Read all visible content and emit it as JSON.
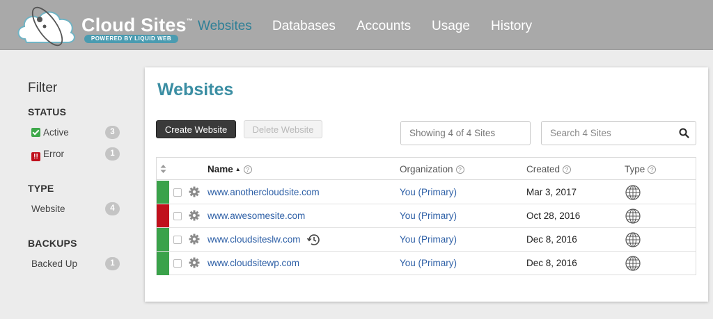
{
  "brand": {
    "title": "Cloud Sites",
    "trademark": "™",
    "tagline": "POWERED BY LIQUID WEB"
  },
  "nav": {
    "items": [
      {
        "label": "Websites",
        "active": true
      },
      {
        "label": "Databases",
        "active": false
      },
      {
        "label": "Accounts",
        "active": false
      },
      {
        "label": "Usage",
        "active": false
      },
      {
        "label": "History",
        "active": false
      }
    ]
  },
  "sidebar": {
    "title": "Filter",
    "status": {
      "heading": "STATUS",
      "items": [
        {
          "label": "Active",
          "count": "3",
          "icon": "check-icon"
        },
        {
          "label": "Error",
          "count": "1",
          "icon": "error-icon"
        }
      ]
    },
    "type": {
      "heading": "TYPE",
      "items": [
        {
          "label": "Website",
          "count": "4"
        }
      ]
    },
    "backups": {
      "heading": "BACKUPS",
      "items": [
        {
          "label": "Backed Up",
          "count": "1"
        }
      ]
    }
  },
  "main": {
    "title": "Websites",
    "create_button": "Create Website",
    "delete_button": "Delete Website",
    "showing_text": "Showing 4 of 4 Sites",
    "search_placeholder": "Search 4 Sites",
    "columns": {
      "name": "Name",
      "sort_indicator": "▲",
      "organization": "Organization",
      "created": "Created",
      "type": "Type"
    },
    "rows": [
      {
        "site": "www.anothercloudsite.com",
        "organization": "You (Primary)",
        "created": "Mar 3, 2017",
        "status": "active",
        "history_icon": false
      },
      {
        "site": "www.awesomesite.com",
        "organization": "You (Primary)",
        "created": "Oct 28, 2016",
        "status": "error",
        "history_icon": false
      },
      {
        "site": "www.cloudsiteslw.com",
        "organization": "You (Primary)",
        "created": "Dec 8, 2016",
        "status": "active",
        "history_icon": true
      },
      {
        "site": "www.cloudsitewp.com",
        "organization": "You (Primary)",
        "created": "Dec 8, 2016",
        "status": "active",
        "history_icon": false
      }
    ]
  },
  "colors": {
    "active": "#3aa24a",
    "error": "#c0101c",
    "accent": "#3b8ea3",
    "link": "#2d5fa6"
  }
}
